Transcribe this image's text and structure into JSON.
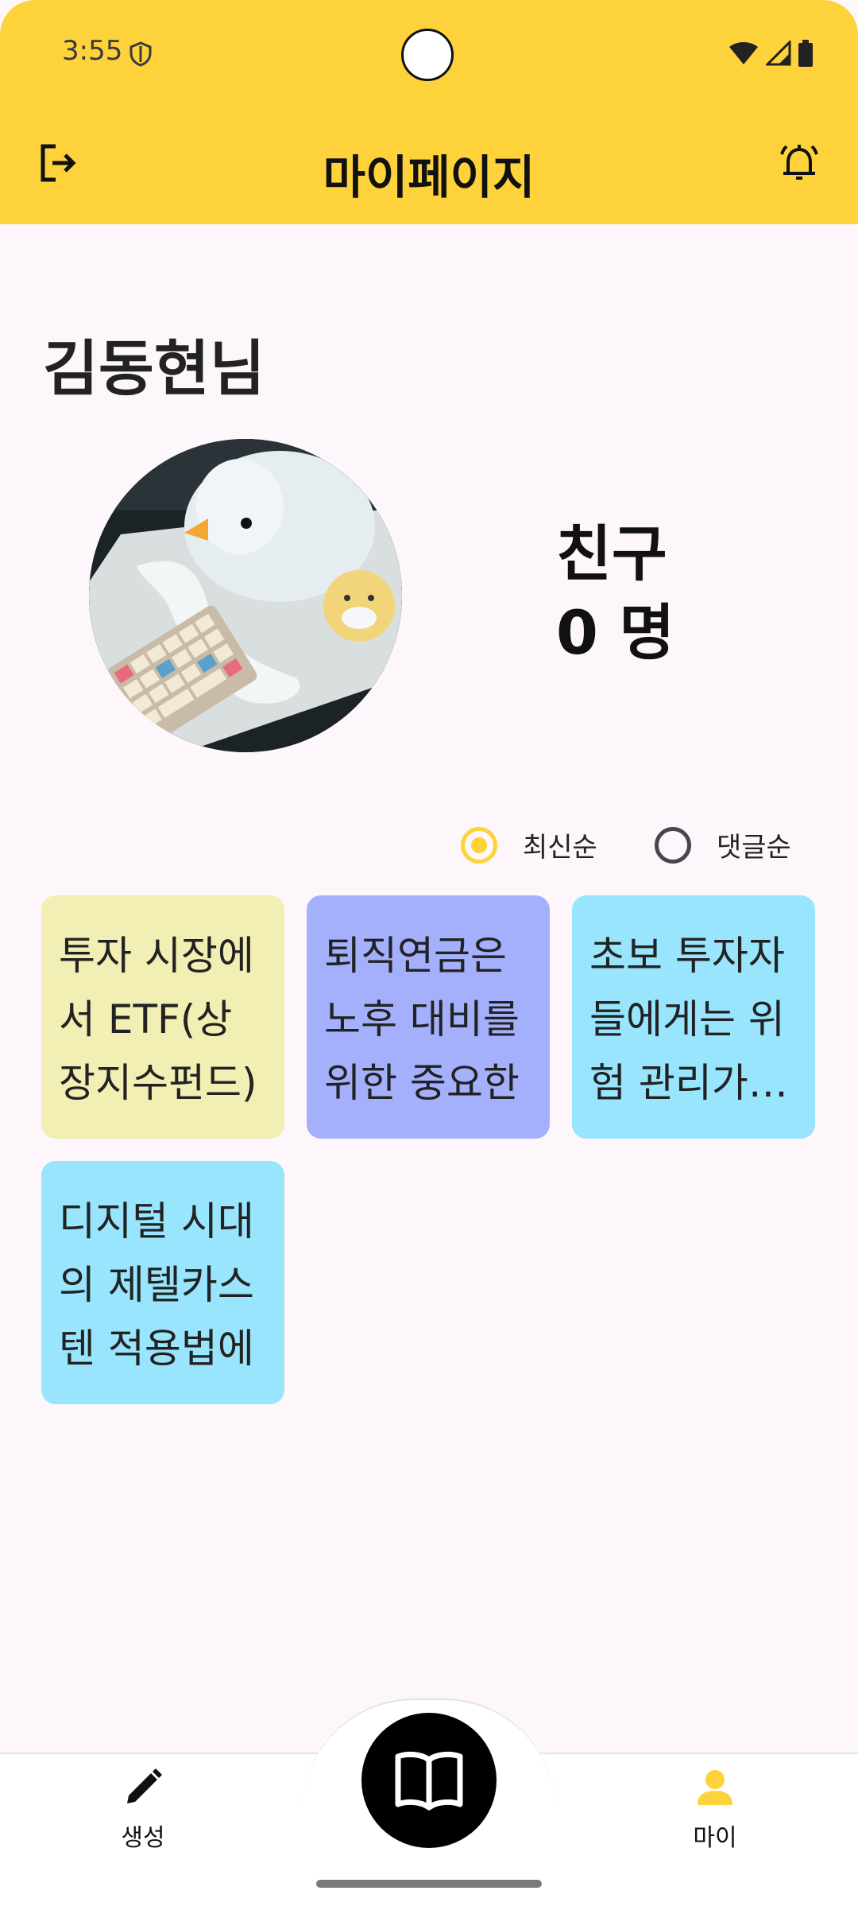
{
  "status": {
    "time": "3:55"
  },
  "header": {
    "title": "마이페이지"
  },
  "profile": {
    "name": "김동현님",
    "friends_label": "친구",
    "friends_count": "0 명"
  },
  "sort": {
    "options": [
      "최신순",
      "댓글순"
    ],
    "selected": "최신순"
  },
  "cards": [
    {
      "text": "투자 시장에서 ETF(상장지수펀드)",
      "color": "#f1efb3"
    },
    {
      "text": "퇴직연금은 노후 대비를 위한 중요한",
      "color": "#a5b0fc"
    },
    {
      "text": "초보 투자자들에게는 위험 관리가 가장",
      "color": "#98e5fd"
    },
    {
      "text": "디지털 시대의 제텔카스텐 적용법에",
      "color": "#98e5fd"
    }
  ],
  "nav": {
    "create_label": "생성",
    "my_label": "마이"
  },
  "colors": {
    "accent": "#fdd23a",
    "background": "#fdf7fc"
  }
}
